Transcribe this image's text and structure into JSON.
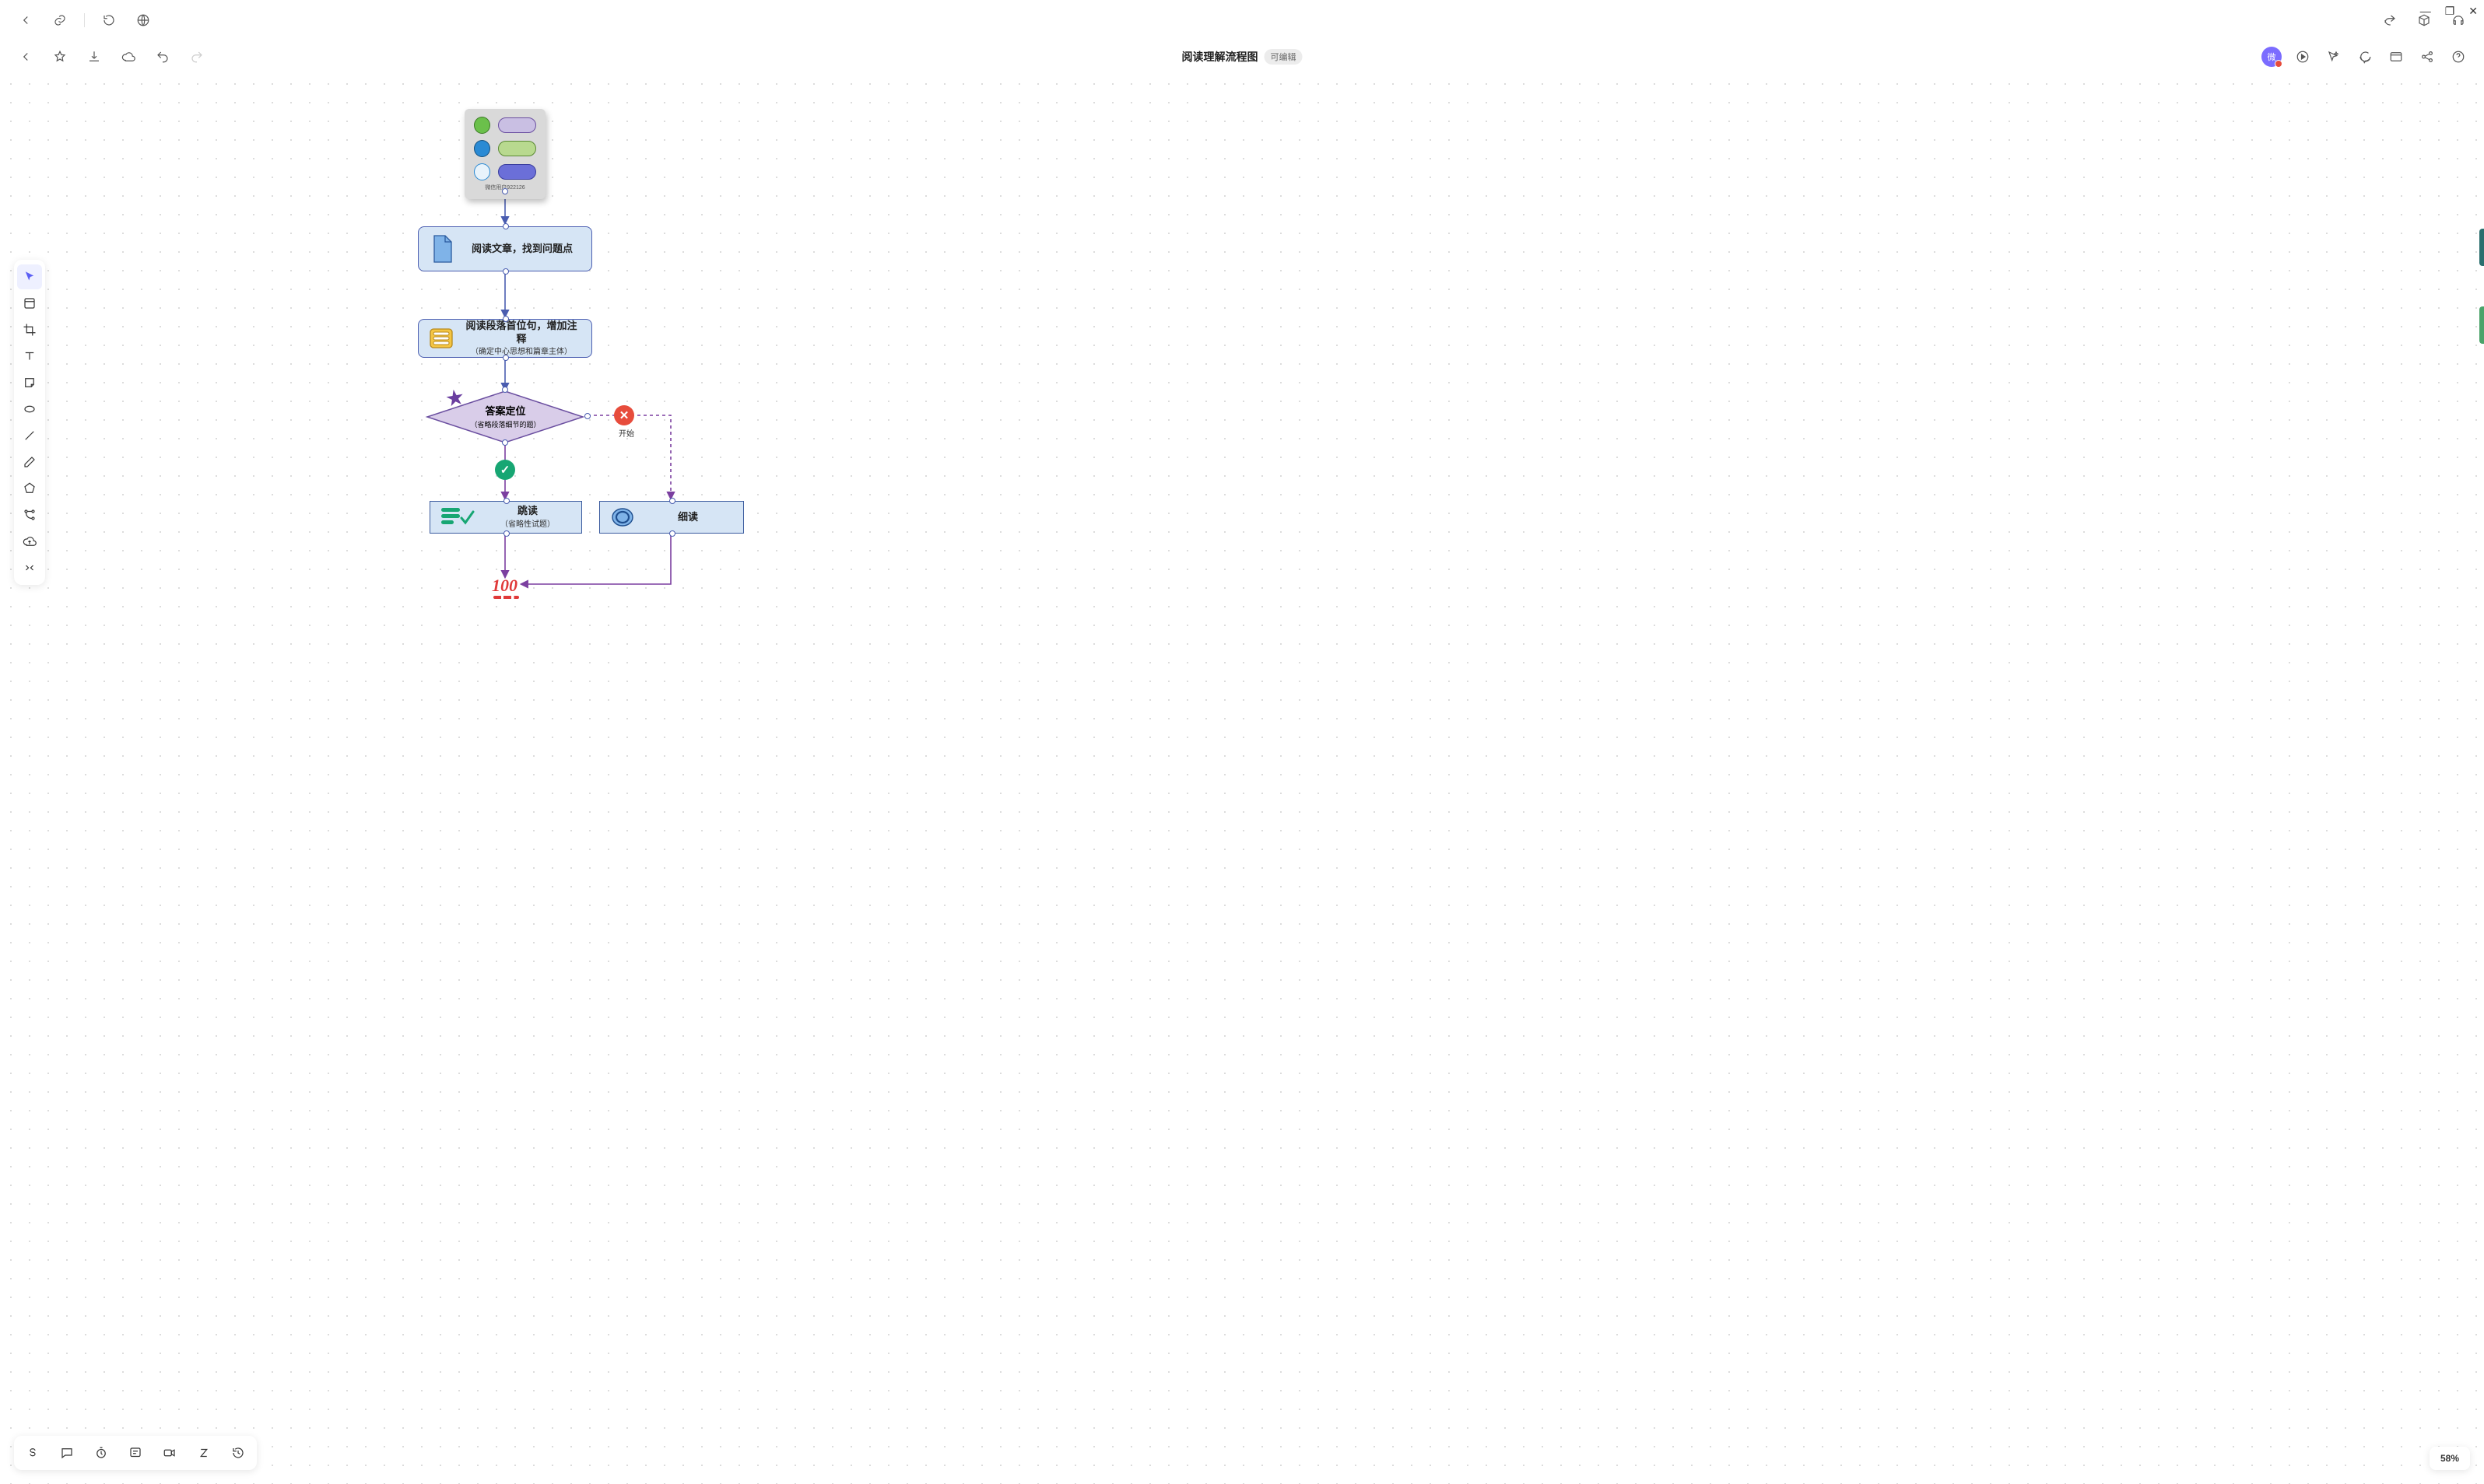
{
  "window_controls": {
    "min": "—",
    "max": "❐",
    "close": "✕"
  },
  "doc": {
    "title": "阅读理解流程图",
    "badge": "可编辑"
  },
  "avatar": "微",
  "zoom": "58%",
  "legend": {
    "caption": "微信用户922126",
    "rows": [
      {
        "swatch": "#6bc04b",
        "swatch_border": "#3a7a25",
        "pill": "#c9bfe3",
        "pill_border": "#6b4fa0"
      },
      {
        "swatch": "#2a8ad4",
        "swatch_border": "#15507e",
        "pill": "#b8d98f",
        "pill_border": "#5a8a33"
      },
      {
        "swatch": "#e8f3fb",
        "swatch_border": "#2a8ad4",
        "pill": "#6b6fd8",
        "pill_border": "#3a3e9e"
      }
    ]
  },
  "nodes": {
    "n1": {
      "title": "阅读文章，找到问题点"
    },
    "n2": {
      "title": "阅读段落首位句，增加注释",
      "sub": "（确定中心思想和篇章主体）"
    },
    "n3": {
      "title": "答案定位",
      "sub": "（省略段落细节的题）"
    },
    "n4": {
      "title": "跳读",
      "sub": "（省略性试题）"
    },
    "n5": {
      "title": "细读"
    }
  },
  "edge_labels": {
    "no": "开始"
  },
  "result_icons": {
    "yes_color": "#17a673",
    "no_color": "#e74c3c"
  },
  "score": "100",
  "colors": {
    "arrow_blue": "#4a5db0",
    "arrow_purple": "#7b3fa0",
    "node_fill": "#d6e5f5",
    "node_border": "#4a5db0",
    "diamond_fill": "#d9cde9",
    "diamond_border": "#6b4fa0"
  }
}
